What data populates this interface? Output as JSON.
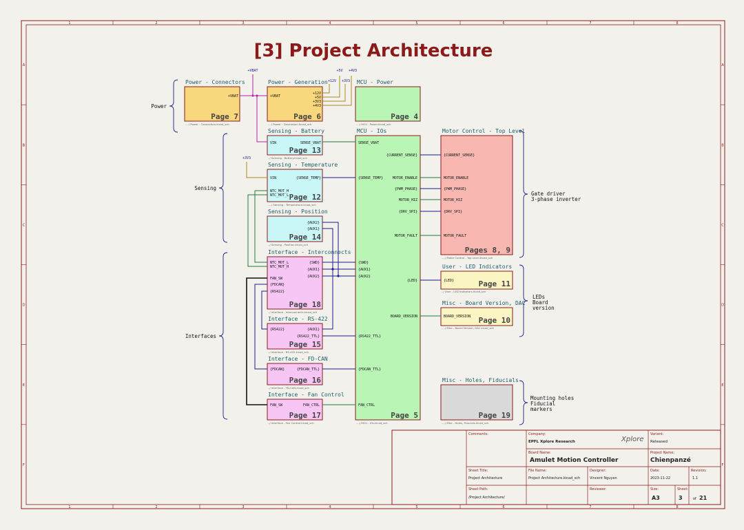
{
  "title": "[3] Project Architecture",
  "frame": {
    "cols": [
      "1",
      "2",
      "3",
      "4",
      "5",
      "6",
      "7",
      "8"
    ],
    "rows": [
      "A",
      "B",
      "C",
      "D",
      "E",
      "F"
    ]
  },
  "colors": {
    "frame": "#8b1a1a",
    "wire": "#1f7a3a",
    "bus": "#1a1a8c",
    "power_wire": "#a58b1f",
    "vbat_wire": "#b01fa8",
    "text_label": "#1a5f6a"
  },
  "groups": {
    "power": "Power",
    "sensing": "Sensing",
    "interfaces": "Interfaces",
    "gate": [
      "Gate driver",
      "3-phase inverter"
    ],
    "leds": [
      "LEDs",
      "Board",
      "version"
    ],
    "mounting": [
      "Mounting holes",
      "Fiducial",
      "markers"
    ]
  },
  "power_symbols": {
    "vbat1": "+VBAT",
    "v5": "+5V",
    "v4v3": "+4V3",
    "v12": "+12V",
    "v3v3a": "+3V3",
    "v3v3b": "+3V3"
  },
  "sheets": {
    "pwr_conn": {
      "title": "Power - Connectors",
      "page": "Page 7",
      "file": "..../ Power - Connectors.kicad_sch",
      "pins": [
        "+VBAT"
      ]
    },
    "pwr_gen": {
      "title": "Power - Generation",
      "page": "Page 6",
      "file": "..../ Power - Generation.kicad_sch",
      "pins": [
        "+VBAT",
        "+12V",
        "+5V",
        "+3V3",
        "+4V3"
      ]
    },
    "mcu_pwr": {
      "title": "MCU - Power",
      "page": "Page 4",
      "file": "..../ MCU - Power.kicad_sch"
    },
    "sens_bat": {
      "title": "Sensing - Battery",
      "page": "Page 13",
      "file": "../ Sensing - Battery.kicad_sch",
      "pins": [
        "VIN",
        "SENSE_VBAT"
      ]
    },
    "sens_temp": {
      "title": "Sensing - Temperature",
      "page": "Page 12",
      "file": "..../ Sensing - Temperature.kicad_sch",
      "pins": [
        "VIN",
        "{SENSE_TEMP}",
        "NTC_MOT_H",
        "NTC_MOT_L"
      ]
    },
    "sens_pos": {
      "title": "Sensing - Position",
      "page": "Page 14",
      "file": "../ Sensing - Position.kicad_sch",
      "pins": [
        "{AUX2}",
        "{AUX1}"
      ]
    },
    "if_inter": {
      "title": "Interface - Interconnects",
      "page": "Page 18",
      "file": "../ Interface - Interconnects.kicad_sch",
      "pins": [
        "NTC_MOT_L",
        "NTC_MOT_H",
        "FAN_SW",
        "{FDCAN}",
        "{RS422}",
        "{SWD}",
        "{AUX1}",
        "{AUX2}"
      ]
    },
    "if_rs422": {
      "title": "Interface - RS-422",
      "page": "Page 15",
      "file": "../ Interface - RS-422.kicad_sch",
      "pins": [
        "{RS422}",
        "{AUX1}",
        "{RS422_TTL}"
      ]
    },
    "if_fdcan": {
      "title": "Interface - FD-CAN",
      "page": "Page 16",
      "file": "../ Interface - FD-CAN.kicad_sch",
      "pins": [
        "{FDCAN}",
        "{FDCAN_TTL}"
      ]
    },
    "if_fan": {
      "title": "Interface - Fan Control",
      "page": "Page 17",
      "file": "../ Interface - Fan Control.kicad_sch",
      "pins": [
        "FAN_SW",
        "FAN_CTRL"
      ]
    },
    "mcu_io": {
      "title": "MCU - IOs",
      "page": "Page 5",
      "file": "..../ MCU - IOs.kicad_sch",
      "pins": [
        "SENSE_VBAT",
        "{CURRENT_SENSE}",
        "{SENSE_TEMP}",
        "MOTOR_ENABLE",
        "{PWM_PHASE}",
        "MOTOR_HIZ",
        "{DRV_SPI}",
        "MOTOR_FAULT",
        "{SWD}",
        "{AUX1}",
        "{AUX2}",
        "{LED}",
        "BOARD_VERSION",
        "{RS422_TTL}",
        "{FDCAN_TTL}",
        "FAN_CTRL"
      ]
    },
    "motor": {
      "title": "Motor Control - Top Level",
      "page": "Pages 8, 9",
      "file": "..../ Motor Control - Top Level.kicad_sch",
      "pins": [
        "{CURRENT_SENSE}",
        "MOTOR_ENABLE",
        "{PWM_PHASE}",
        "MOTOR_HIZ",
        "{DRV_SPI}",
        "MOTOR_FAULT"
      ]
    },
    "led": {
      "title": "User - LED Indicators",
      "page": "Page 11",
      "file": "../ User - LED Indicators.kicad_sch",
      "pins": [
        "{LED}"
      ]
    },
    "bver": {
      "title": "Misc - Board Version, DAC",
      "page": "Page 10",
      "file": "..../ Misc - Board Version, DAC.kicad_sch",
      "pins": [
        "BOARD_VERSION"
      ]
    },
    "holes": {
      "title": "Misc - Holes, Fiducials",
      "page": "Page 19",
      "file": "..../ Misc - Holes, Fiducials.kicad_sch"
    }
  },
  "title_block": {
    "comments_label": "Comments:",
    "company_label": "Company:",
    "company": "EPFL Xplore Research",
    "logo_text": "Xplore",
    "variant_label": "Variant:",
    "variant": "Released",
    "board_name_label": "Board Name:",
    "board_name": "Amulet Motion Controller",
    "project_name_label": "Project Name:",
    "project_name": "Chienpanzé",
    "sheet_title_label": "Sheet Title:",
    "sheet_title": "Project Architecture",
    "file_name_label": "File Name:",
    "file_name": "Project Architecture.kicad_sch",
    "designer_label": "Designer:",
    "designer": "Vincent Nguyen",
    "date_label": "Date:",
    "date": "2023-11-22",
    "revision_label": "Revision:",
    "revision": "1.1",
    "sheet_path_label": "Sheet Path:",
    "sheet_path": "/Project Architecture/",
    "reviewer_label": "Reviewer:",
    "size_label": "Size:",
    "size": "A3",
    "sheet_label": "Sheet:",
    "sheet_num": "3",
    "of": "of",
    "sheet_total": "21"
  }
}
